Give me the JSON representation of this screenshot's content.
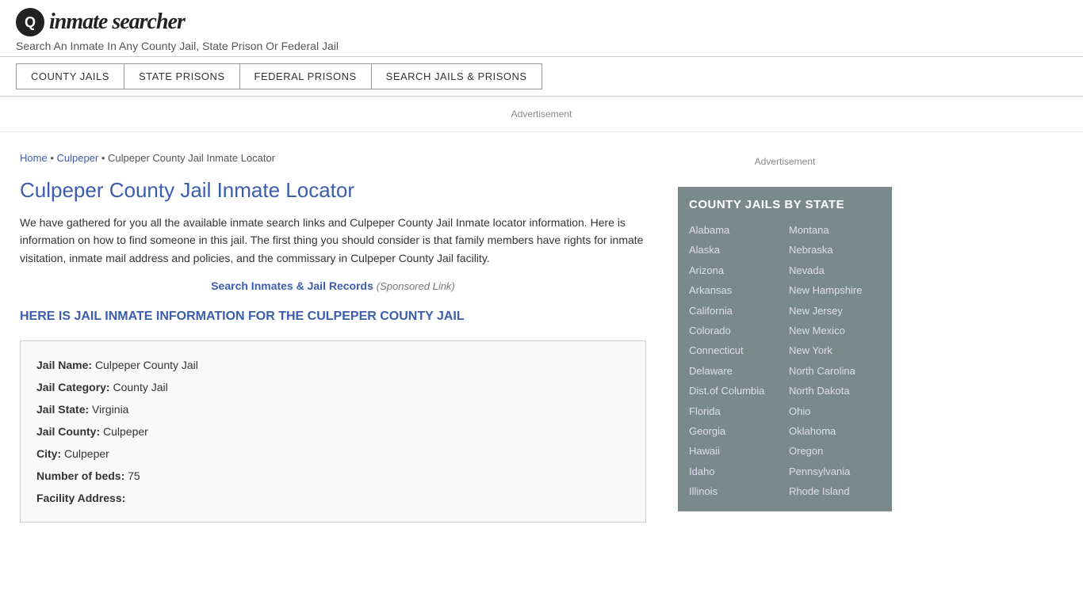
{
  "header": {
    "logo_symbol": "🔍",
    "logo_text": "inmate searcher",
    "tagline": "Search An Inmate In Any County Jail, State Prison Or Federal Jail"
  },
  "nav": {
    "items": [
      {
        "label": "COUNTY JAILS"
      },
      {
        "label": "STATE PRISONS"
      },
      {
        "label": "FEDERAL PRISONS"
      },
      {
        "label": "SEARCH JAILS & PRISONS"
      }
    ]
  },
  "ad_label": "Advertisement",
  "breadcrumb": {
    "home": "Home",
    "parent": "Culpeper",
    "current": "Culpeper County Jail Inmate Locator"
  },
  "page_title": "Culpeper County Jail Inmate Locator",
  "body_text": "We have gathered for you all the available inmate search links and Culpeper County Jail Inmate locator information. Here is information on how to find someone in this jail. The first thing you should consider is that family members have rights for inmate visitation, inmate mail address and policies, and the commissary in Culpeper County Jail facility.",
  "sponsored": {
    "link_text": "Search Inmates & Jail Records",
    "label": "(Sponsored Link)"
  },
  "section_header": "HERE IS JAIL INMATE INFORMATION FOR THE CULPEPER COUNTY JAIL",
  "jail_info": {
    "fields": [
      {
        "label": "Jail Name:",
        "value": "Culpeper County Jail"
      },
      {
        "label": "Jail Category:",
        "value": "County Jail"
      },
      {
        "label": "Jail State:",
        "value": "Virginia"
      },
      {
        "label": "Jail County:",
        "value": "Culpeper"
      },
      {
        "label": "City:",
        "value": "Culpeper"
      },
      {
        "label": "Number of beds:",
        "value": "75"
      },
      {
        "label": "Facility Address:",
        "value": ""
      }
    ]
  },
  "sidebar": {
    "ad_label": "Advertisement",
    "state_box_title": "COUNTY JAILS BY STATE",
    "states_left": [
      "Alabama",
      "Alaska",
      "Arizona",
      "Arkansas",
      "California",
      "Colorado",
      "Connecticut",
      "Delaware",
      "Dist.of Columbia",
      "Florida",
      "Georgia",
      "Hawaii",
      "Idaho",
      "Illinois"
    ],
    "states_right": [
      "Montana",
      "Nebraska",
      "Nevada",
      "New Hampshire",
      "New Jersey",
      "New Mexico",
      "New York",
      "North Carolina",
      "North Dakota",
      "Ohio",
      "Oklahoma",
      "Oregon",
      "Pennsylvania",
      "Rhode Island"
    ]
  }
}
